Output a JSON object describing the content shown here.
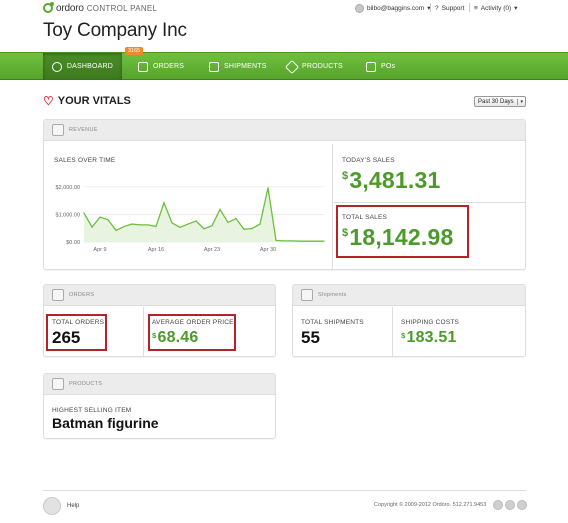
{
  "app": {
    "logo_name": "ordoro",
    "logo_sub": "CONTROL PANEL",
    "company": "Toy Company Inc"
  },
  "topbar": {
    "user_email": "bilbo@baggins.com",
    "support_label": "Support",
    "activity_label": "Activity (0)"
  },
  "nav": {
    "items": [
      {
        "label": "DASHBOARD",
        "icon": "dashboard-icon",
        "active": true
      },
      {
        "label": "ORDERS",
        "icon": "orders-icon",
        "badge": "3165"
      },
      {
        "label": "SHIPMENTS",
        "icon": "shipments-icon"
      },
      {
        "label": "PRODUCTS",
        "icon": "products-icon"
      },
      {
        "label": "POs",
        "icon": "pos-icon"
      }
    ]
  },
  "vitals": {
    "title": "YOUR VITALS",
    "period": "Past 30 Days"
  },
  "revenue": {
    "header": "REVENUE",
    "chart_title": "SALES OVER TIME",
    "todays_sales_label": "TODAY'S SALES",
    "todays_sales_value": "3,481.31",
    "total_sales_label": "TOTAL SALES",
    "total_sales_value": "18,142.98",
    "currency": "$"
  },
  "chart_data": {
    "type": "area",
    "title": "SALES OVER TIME",
    "xlabel": "",
    "ylabel": "",
    "y_ticks": [
      "$2,000.00",
      "$1,000.00",
      "$0.00"
    ],
    "x_ticks": [
      "Apr 9",
      "Apr 16",
      "Apr 23",
      "Apr 30"
    ],
    "ylim": [
      0,
      2500
    ],
    "series": [
      {
        "values": [
          1050,
          540,
          900,
          810,
          420,
          560,
          650,
          620,
          620,
          560,
          1420,
          690,
          530,
          650,
          760,
          480,
          590,
          1180,
          710,
          850,
          460,
          490,
          650,
          1960,
          60,
          40,
          40,
          30,
          30,
          30,
          30
        ]
      }
    ],
    "grid": true,
    "color": "#6cbf3f"
  },
  "orders": {
    "header": "ORDERS",
    "total_label": "TOTAL ORDERS",
    "total_value": "265",
    "avg_label": "AVERAGE ORDER PRICE",
    "avg_value": "68.46",
    "currency": "$"
  },
  "shipments": {
    "header": "Shipments",
    "total_label": "TOTAL SHIPMENTS",
    "total_value": "55",
    "cost_label": "SHIPPING COSTS",
    "cost_value": "183.51",
    "currency": "$"
  },
  "products": {
    "header": "PRODUCTS",
    "best_label": "HIGHEST SELLING ITEM",
    "best_value": "Batman figurine"
  },
  "footer": {
    "help_label": "Help",
    "copyright": "Copyright © 2009-2012 Ordoro. 512.271.9453"
  },
  "colors": {
    "brand_green": "#5aa832",
    "value_green": "#4c9a2a",
    "highlight_red": "#b3232a",
    "badge_orange": "#f08a24"
  }
}
